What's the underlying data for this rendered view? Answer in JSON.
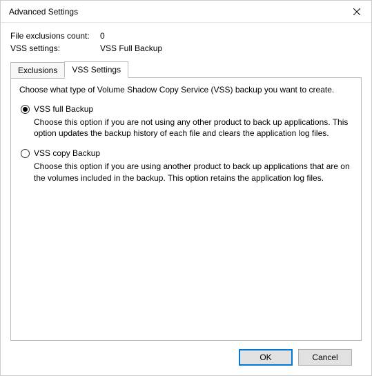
{
  "window": {
    "title": "Advanced Settings"
  },
  "info": {
    "file_exclusions_label": "File exclusions count:",
    "file_exclusions_value": "0",
    "vss_settings_label": "VSS settings:",
    "vss_settings_value": "VSS Full Backup"
  },
  "tabs": {
    "exclusions": "Exclusions",
    "vss_settings": "VSS Settings"
  },
  "panel": {
    "description": "Choose what type of Volume Shadow Copy Service (VSS) backup you want to create.",
    "options": {
      "full": {
        "label": "VSS full Backup",
        "desc": "Choose this option if you are not using any other product to back up applications. This option updates the backup history of each file and clears the application log files."
      },
      "copy": {
        "label": "VSS copy Backup",
        "desc": "Choose this option if you are using another product to back up applications that are on the volumes included in the backup. This option retains the application log files."
      }
    }
  },
  "buttons": {
    "ok": "OK",
    "cancel": "Cancel"
  }
}
